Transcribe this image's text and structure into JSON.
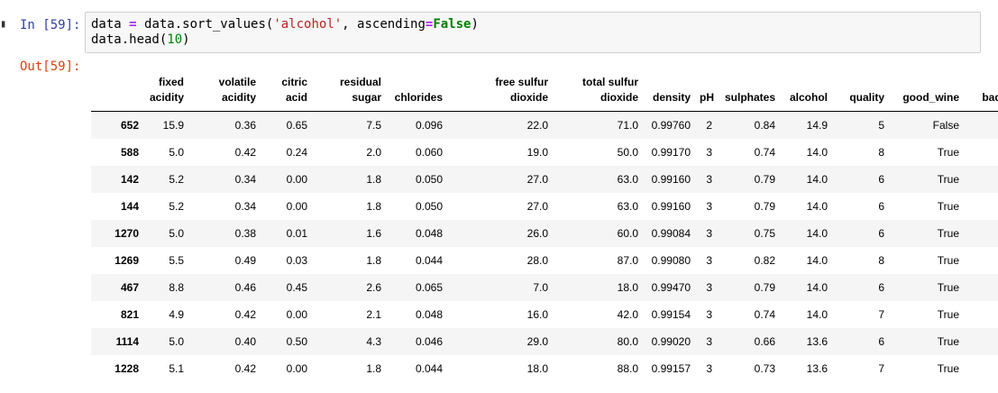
{
  "cell": {
    "in_prompt": "In [59]:",
    "out_prompt": "Out[59]:",
    "code": {
      "line1": {
        "var": "data ",
        "op": "=",
        "call": " data.sort_values(",
        "str": "'alcohol'",
        "kwarg": ", ascending",
        "eq": "=",
        "kw": "False",
        "close": ")"
      },
      "line2": {
        "call": "data.head(",
        "num": "10",
        "close": ")"
      }
    }
  },
  "table": {
    "columns": [
      [
        "fixed",
        "acidity"
      ],
      [
        "volatile",
        "acidity"
      ],
      [
        "citric",
        "acid"
      ],
      [
        "residual",
        "sugar"
      ],
      [
        "chlorides"
      ],
      [
        "free sulfur",
        "dioxide"
      ],
      [
        "total sulfur",
        "dioxide"
      ],
      [
        "density"
      ],
      [
        "pH"
      ],
      [
        "sulphates"
      ],
      [
        "alcohol"
      ],
      [
        "quality"
      ],
      [
        "good_wine"
      ],
      [
        "bad_wine"
      ]
    ],
    "rows": [
      {
        "index": "652",
        "values": [
          "15.9",
          "0.36",
          "0.65",
          "7.5",
          "0.096",
          "22.0",
          "71.0",
          "0.99760",
          "2",
          "0.84",
          "14.9",
          "5",
          "False",
          "True"
        ]
      },
      {
        "index": "588",
        "values": [
          "5.0",
          "0.42",
          "0.24",
          "2.0",
          "0.060",
          "19.0",
          "50.0",
          "0.99170",
          "3",
          "0.74",
          "14.0",
          "8",
          "True",
          "False"
        ]
      },
      {
        "index": "142",
        "values": [
          "5.2",
          "0.34",
          "0.00",
          "1.8",
          "0.050",
          "27.0",
          "63.0",
          "0.99160",
          "3",
          "0.79",
          "14.0",
          "6",
          "True",
          "False"
        ]
      },
      {
        "index": "144",
        "values": [
          "5.2",
          "0.34",
          "0.00",
          "1.8",
          "0.050",
          "27.0",
          "63.0",
          "0.99160",
          "3",
          "0.79",
          "14.0",
          "6",
          "True",
          "False"
        ]
      },
      {
        "index": "1270",
        "values": [
          "5.0",
          "0.38",
          "0.01",
          "1.6",
          "0.048",
          "26.0",
          "60.0",
          "0.99084",
          "3",
          "0.75",
          "14.0",
          "6",
          "True",
          "False"
        ]
      },
      {
        "index": "1269",
        "values": [
          "5.5",
          "0.49",
          "0.03",
          "1.8",
          "0.044",
          "28.0",
          "87.0",
          "0.99080",
          "3",
          "0.82",
          "14.0",
          "8",
          "True",
          "False"
        ]
      },
      {
        "index": "467",
        "values": [
          "8.8",
          "0.46",
          "0.45",
          "2.6",
          "0.065",
          "7.0",
          "18.0",
          "0.99470",
          "3",
          "0.79",
          "14.0",
          "6",
          "True",
          "False"
        ]
      },
      {
        "index": "821",
        "values": [
          "4.9",
          "0.42",
          "0.00",
          "2.1",
          "0.048",
          "16.0",
          "42.0",
          "0.99154",
          "3",
          "0.74",
          "14.0",
          "7",
          "True",
          "False"
        ]
      },
      {
        "index": "1114",
        "values": [
          "5.0",
          "0.40",
          "0.50",
          "4.3",
          "0.046",
          "29.0",
          "80.0",
          "0.99020",
          "3",
          "0.66",
          "13.6",
          "6",
          "True",
          "False"
        ]
      },
      {
        "index": "1228",
        "values": [
          "5.1",
          "0.42",
          "0.00",
          "1.8",
          "0.044",
          "18.0",
          "88.0",
          "0.99157",
          "3",
          "0.73",
          "13.6",
          "7",
          "True",
          "False"
        ]
      }
    ]
  }
}
